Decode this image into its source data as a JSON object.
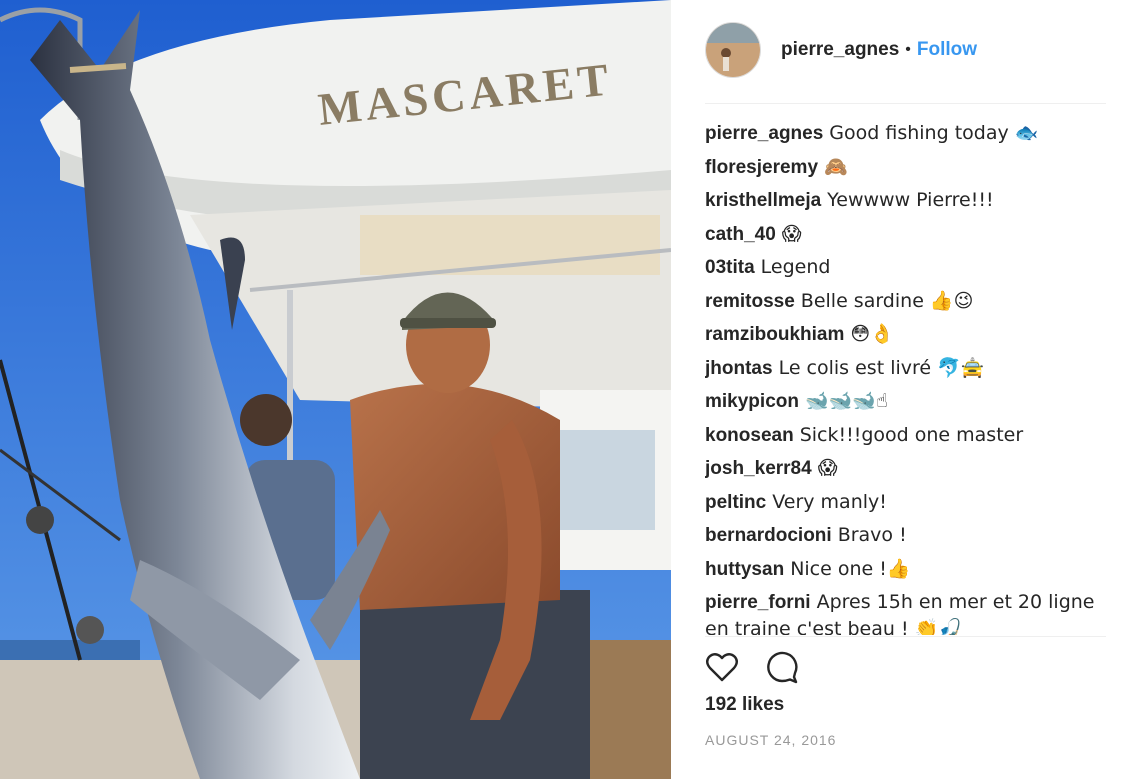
{
  "post": {
    "boat_name": "MASCARET",
    "author": "pierre_agnes",
    "separator": "•",
    "follow_label": "Follow",
    "likes": "192 likes",
    "date": "AUGUST 24, 2016"
  },
  "comments": [
    {
      "author": "pierre_agnes",
      "text": "Good fishing today 🐟"
    },
    {
      "author": "floresjeremy",
      "text": "🙈"
    },
    {
      "author": "kristhellmeja",
      "text": "Yewwww Pierre!!!"
    },
    {
      "author": "cath_40",
      "text": "😱"
    },
    {
      "author": "03tita",
      "text": "Legend"
    },
    {
      "author": "remitosse",
      "text": "Belle sardine 👍😉"
    },
    {
      "author": "ramziboukhiam",
      "text": "😳👌"
    },
    {
      "author": "jhontas",
      "text": "Le colis est livré 🐬🚖"
    },
    {
      "author": "mikypicon",
      "text": "🐋🐋🐋☝"
    },
    {
      "author": "konosean",
      "text": "Sick!!!good one master"
    },
    {
      "author": "josh_kerr84",
      "text": "😱"
    },
    {
      "author": "peltinc",
      "text": "Very manly!"
    },
    {
      "author": "bernardocioni",
      "text": "Bravo !"
    },
    {
      "author": "huttysan",
      "text": "Nice one !👍"
    },
    {
      "author": "pierre_forni",
      "text": "Apres 15h en mer et 20 ligne en traine c'est beau ! 👏🎣"
    }
  ],
  "icons": {
    "like": "heart-icon",
    "comment": "comment-icon"
  },
  "colors": {
    "follow": "#3897f0",
    "text": "#262626",
    "muted": "#999999",
    "sky": "#2a6fd6"
  }
}
